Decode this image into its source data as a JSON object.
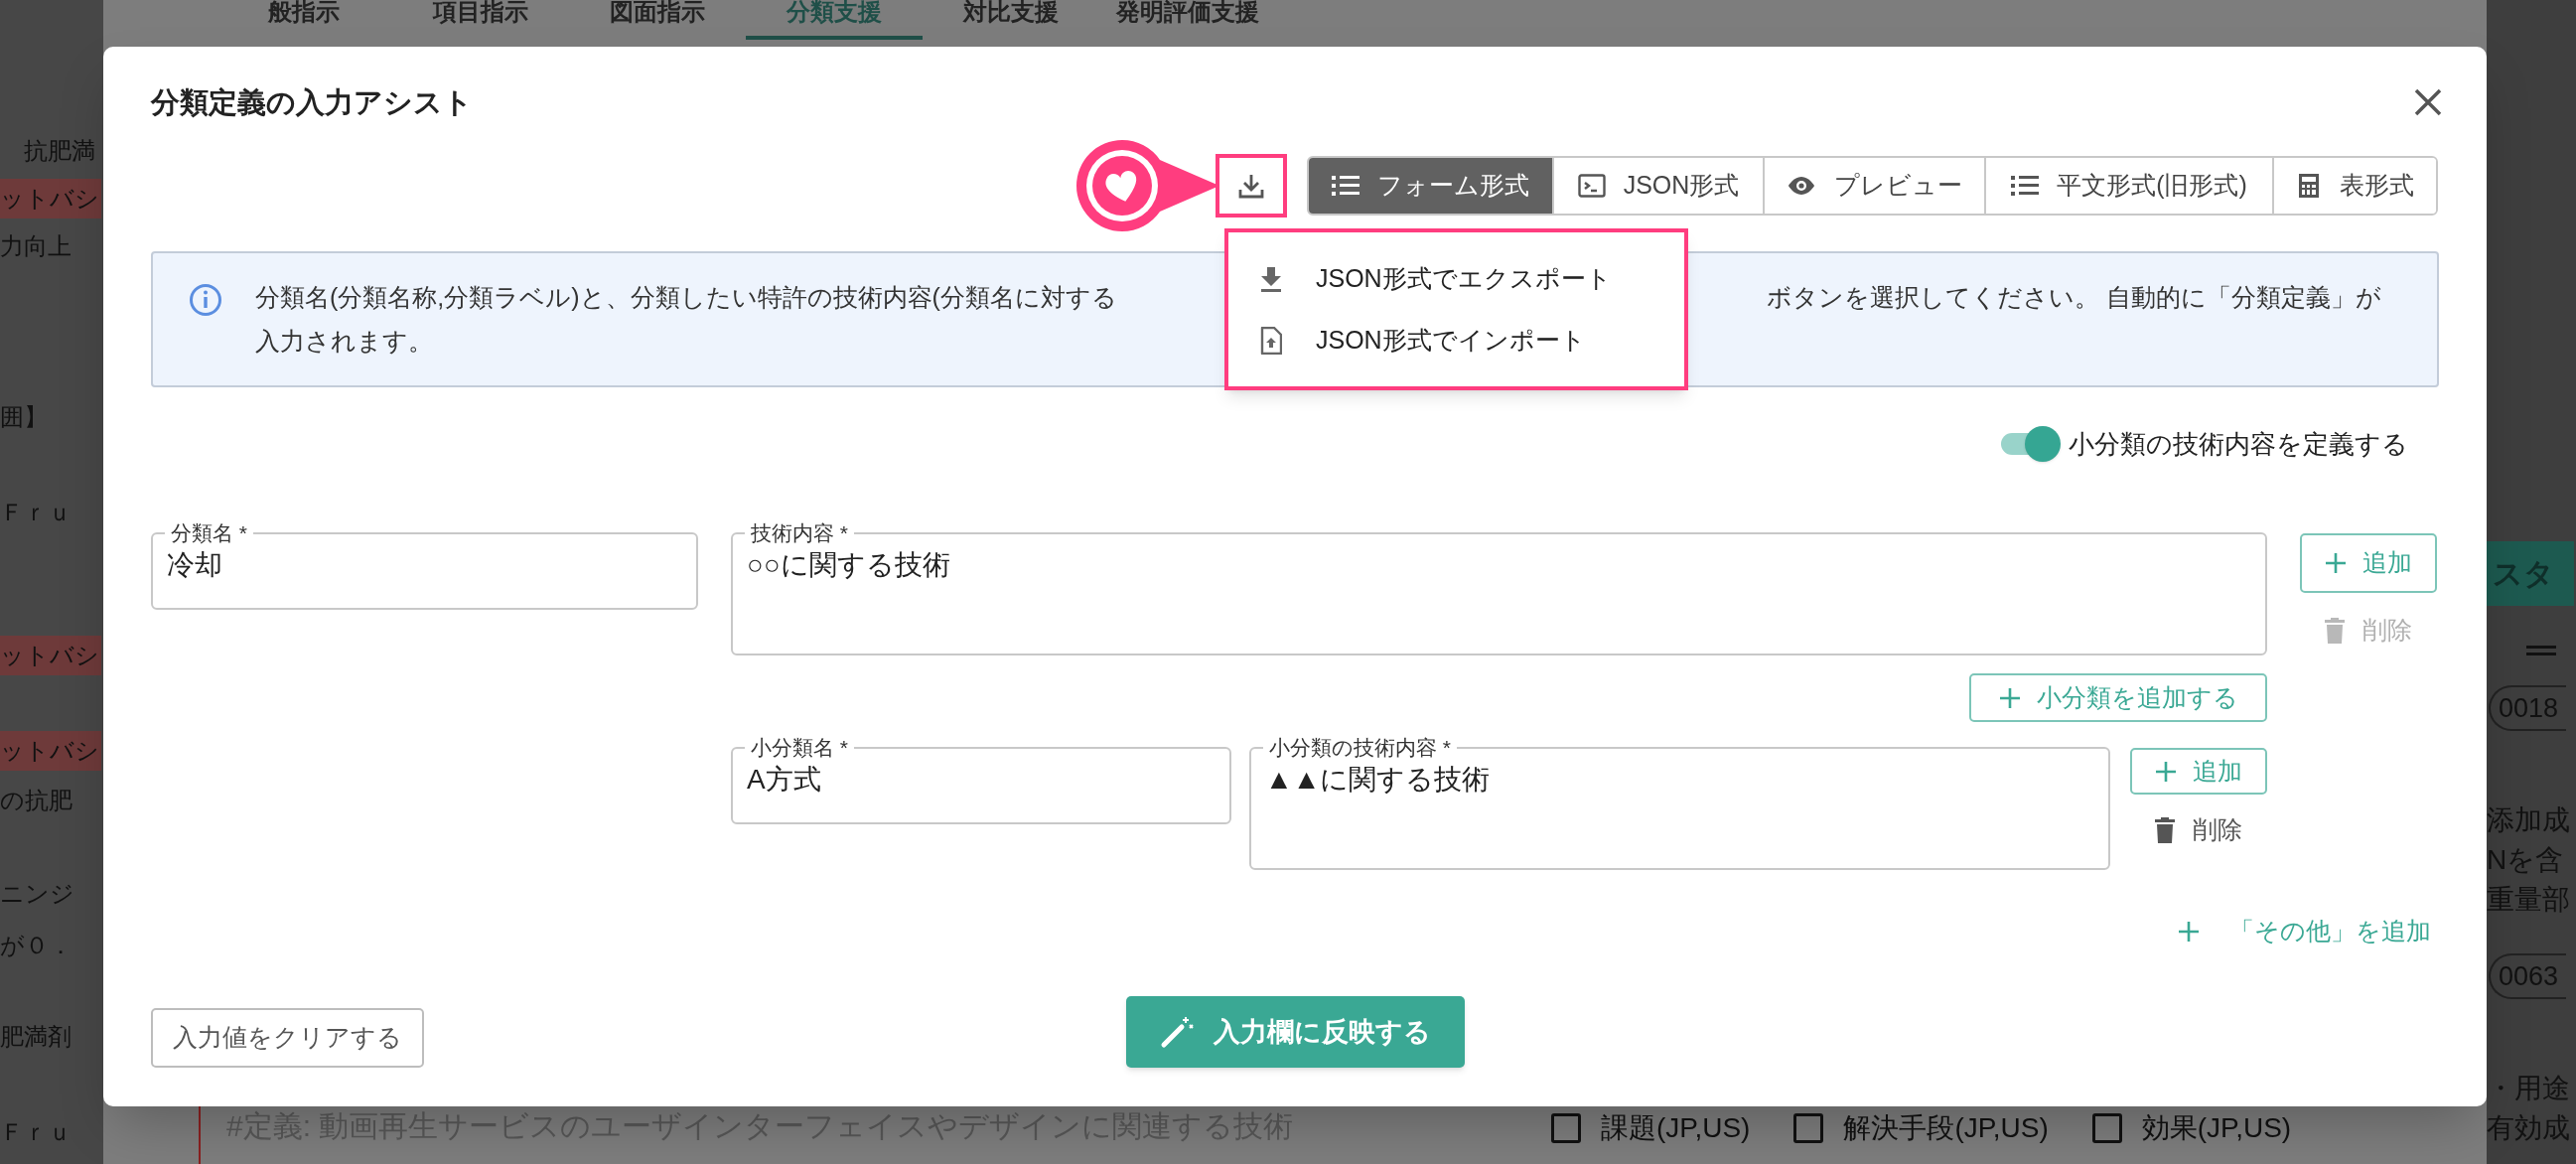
{
  "background": {
    "tabs": [
      {
        "label": "般指示",
        "selected": false
      },
      {
        "label": "項目指示",
        "selected": false
      },
      {
        "label": "図面指示",
        "selected": false
      },
      {
        "label": "分類支援",
        "selected": true
      },
      {
        "label": "対比支援",
        "selected": false
      },
      {
        "label": "発明評価支援",
        "selected": false
      }
    ],
    "left_lines": [
      {
        "text": "抗肥満",
        "highlighted": false
      },
      {
        "text": "ットバシ",
        "highlighted": true
      },
      {
        "text": "力向上",
        "highlighted": false
      },
      {
        "text": "囲】",
        "highlighted": false
      },
      {
        "text": "Ｆｒｕ",
        "highlighted": false
      },
      {
        "text": "ットバシ",
        "highlighted": true
      },
      {
        "text": "ットバシ",
        "highlighted": true
      },
      {
        "text": "の抗肥",
        "highlighted": false
      },
      {
        "text": "ニンジ",
        "highlighted": false
      },
      {
        "text": "が０．",
        "highlighted": false
      },
      {
        "text": "肥満剤",
        "highlighted": false
      },
      {
        "text": "Ｆｒｕ",
        "highlighted": false
      }
    ],
    "definition_text": "#定義: 動画再生サービスのユーザインターフェイスやデザインに関連する技術",
    "checkboxes": [
      {
        "label": "課題(JP,US)",
        "checked": false
      },
      {
        "label": "解決手段(JP,US)",
        "checked": false
      },
      {
        "label": "効果(JP,US)",
        "checked": false
      }
    ],
    "right_items": [
      {
        "kind": "button",
        "text": "スタ"
      },
      {
        "kind": "chip",
        "text": "0018"
      },
      {
        "kind": "text",
        "text": "添加成"
      },
      {
        "kind": "text",
        "text": "Nを含"
      },
      {
        "kind": "text",
        "text": "重量部"
      },
      {
        "kind": "chip",
        "text": "0063"
      },
      {
        "kind": "text",
        "text": "・用途"
      },
      {
        "kind": "text",
        "text": "有効成"
      }
    ]
  },
  "dialog": {
    "title": "分類定義の入力アシスト",
    "view_tabs": [
      {
        "label": "フォーム形式",
        "selected": true
      },
      {
        "label": "JSON形式",
        "selected": false
      },
      {
        "label": "プレビュー",
        "selected": false
      },
      {
        "label": "平文形式(旧形式)",
        "selected": false
      },
      {
        "label": "表形式",
        "selected": false
      }
    ],
    "export_menu": {
      "items": [
        {
          "label": "JSON形式でエクスポート"
        },
        {
          "label": "JSON形式でインポート"
        }
      ]
    },
    "info_line_start": "分類名(分類名称,分類ラベル)と、分類したい特許の技術内容(分類名に対する",
    "info_line_end": "ボタンを選択してください。 自動的に「分類定義」が",
    "info_line_2": "入力されます。",
    "toggle": {
      "label": "小分類の技術内容を定義する",
      "on": true
    },
    "categories": [
      {
        "name_label": "分類名 *",
        "name": "冷却",
        "content_label": "技術内容 *",
        "content": "○○に関する技術",
        "add": "追加",
        "delete": "削除",
        "delete_disabled": true,
        "add_sub": "小分類を追加する",
        "subcategories": [
          {
            "name_label": "小分類名 *",
            "name": "A方式",
            "content_label": "小分類の技術内容 *",
            "content": "▲▲に関する技術",
            "add": "追加",
            "delete": "削除",
            "delete_disabled": false
          }
        ]
      }
    ],
    "add_other": "「その他」を追加",
    "clear_button": "入力値をクリアする",
    "apply_button": "入力欄に反映する"
  }
}
